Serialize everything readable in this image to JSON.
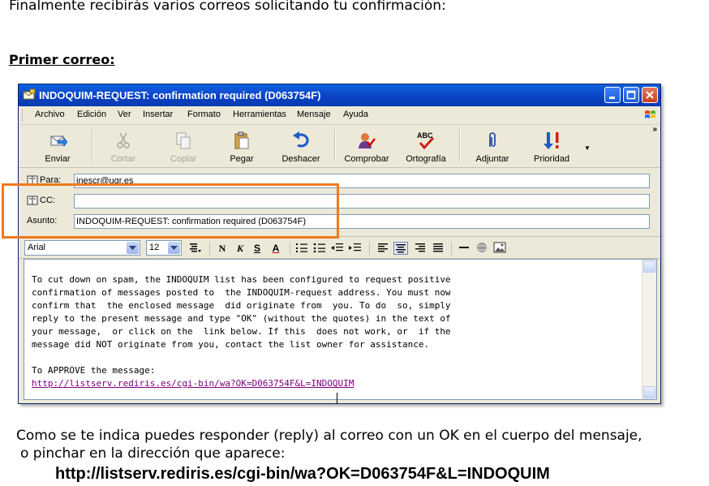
{
  "intro_text": "Finalmente recibirás varios correos solicitando tu confirmación:",
  "section_title": "Primer correo:",
  "window": {
    "title": "INDOQUIM-REQUEST: confirmation required (D063754F)"
  },
  "menubar": {
    "items": [
      "Archivo",
      "Edición",
      "Ver",
      "Insertar",
      "Formato",
      "Herramientas",
      "Mensaje",
      "Ayuda"
    ]
  },
  "toolbar": {
    "buttons": [
      {
        "label": "Enviar",
        "icon": "send-icon",
        "enabled": true
      },
      {
        "label": "Cortar",
        "icon": "scissors-icon",
        "enabled": false
      },
      {
        "label": "Copiar",
        "icon": "copy-icon",
        "enabled": false
      },
      {
        "label": "Pegar",
        "icon": "paste-icon",
        "enabled": true
      },
      {
        "label": "Deshacer",
        "icon": "undo-icon",
        "enabled": true
      },
      {
        "label": "Comprobar",
        "icon": "check-names-icon",
        "enabled": true
      },
      {
        "label": "Ortografía",
        "icon": "spelling-icon",
        "enabled": true
      },
      {
        "label": "Adjuntar",
        "icon": "paperclip-icon",
        "enabled": true
      },
      {
        "label": "Prioridad",
        "icon": "priority-icon",
        "enabled": true
      }
    ],
    "overflow": "»"
  },
  "fields": {
    "to_label": "Para:",
    "to_value": "inescr@ugr.es",
    "cc_label": "CC:",
    "cc_value": "",
    "subject_label": "Asunto:",
    "subject_value": "INDOQUIM-REQUEST: confirmation required (D063754F)"
  },
  "format": {
    "font": "Arial",
    "size": "12",
    "bold": "N",
    "italic": "K",
    "underline": "S",
    "color": "A"
  },
  "message": {
    "lines": [
      "To cut down on spam, the INDOQUIM list has been configured to request positive",
      "confirmation of messages posted to  the INDOQUIM-request address. You must now",
      "confirm that  the enclosed message  did originate from  you. To do  so, simply",
      "reply to the present message and type \"OK\" (without the quotes) in the text of",
      "your message,  or click on the  link below. If this  does not work, or  if the",
      "message did NOT originate from you, contact the list owner for assistance.",
      "",
      "To APPROVE the message:"
    ],
    "link": "http://listserv.rediris.es/cgi-bin/wa?OK=D063754F&L=INDOQUIM"
  },
  "outro_line1": "Como se te indica puedes responder (reply) al correo con un OK en el cuerpo del mensaje,",
  "outro_line2": "o pinchar en la dirección que aparece:",
  "big_url": "http://listserv.rediris.es/cgi-bin/wa?OK=D063754F&L=INDOQUIM",
  "colors": {
    "highlight": "#f07a1c",
    "titlebar": "#0841c1",
    "link": "#800080"
  }
}
